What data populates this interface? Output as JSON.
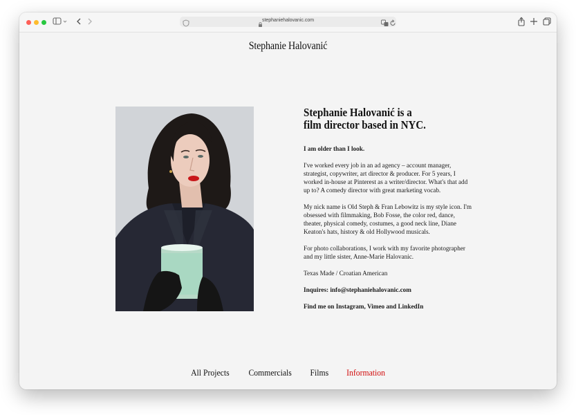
{
  "browser": {
    "url": "stephaniehalovanic.com",
    "icons": [
      "sidebar-icon",
      "back-icon",
      "forward-icon",
      "shield-icon",
      "lock-icon",
      "translate-icon",
      "reload-icon",
      "share-icon",
      "new-tab-icon",
      "tabs-icon"
    ]
  },
  "site": {
    "title": "Stephanie Halovanić"
  },
  "intro": {
    "heading_line1": "Stephanie Halovanić is a",
    "heading_line2": "film director based in NYC."
  },
  "bio": {
    "tagline": "I am older than I look.",
    "p1": "I've worked every job in an ad agency – account manager, strategist, copywriter, art director & producer. For 5 years, I worked in-house at Pinterest as a writer/director. What's that add up to? A comedy director with great marketing vocab.",
    "p2": "My nick name is Old Steph & Fran Lebowitz is my style icon. I'm obsessed with filmmaking, Bob Fosse, the color red, dance, theater, physical comedy, costumes, a good neck line, Diane Keaton's hats, history & old Hollywood musicals.",
    "p3": "For photo collaborations, I work with my favorite photographer and my little sister, Anne-Marie Halovanic.",
    "p4": "Texas Made / Croatian American",
    "inquiries": "Inquires: info@stephaniehalovanic.com",
    "social": "Find me on Instagram, Vimeo and LinkedIn"
  },
  "nav": {
    "items": [
      "All Projects",
      "Commercials",
      "Films",
      "Information"
    ],
    "active": "Information"
  },
  "colors": {
    "accent": "#d10a0a",
    "background": "#f4f4f4",
    "lipstick": "#c8171a"
  }
}
